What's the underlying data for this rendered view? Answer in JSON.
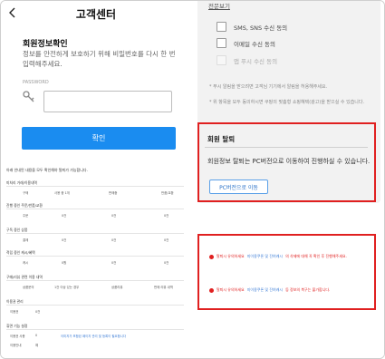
{
  "left": {
    "title": "고객센터",
    "section_title": "회원정보확인",
    "section_desc": "정보를 안전하게 보호하기 위해 비밀번호를 다시 한 번 입력해주세요.",
    "password_label": "PASSWORD",
    "password_value": "",
    "confirm_label": "확인"
  },
  "doc": {
    "note": "아래 안내된 내용을 모두 확인해야 탈퇴가 가능합니다.",
    "sections": [
      "미처리 거래/이용내역",
      "진행 중인 주문/반품/교환",
      "구독 중인 상품",
      "적립 중인 캐시/혜택",
      "구매/리뷰 관련 이용 내역",
      "이용권 관리",
      "휴면 기능 설정"
    ],
    "row1": [
      "구매",
      "사용 중 1개",
      "판매중",
      "반품/교환"
    ],
    "row2": [
      "주문",
      "0건",
      "0건",
      "0건"
    ],
    "row3": [
      "결제",
      "0건",
      "0건",
      "0건"
    ],
    "row4": [
      "캐시",
      "0원",
      "0건",
      "0건"
    ],
    "row5": [
      "상품문의",
      "1건 이상 있는 경우",
      "상품리뷰",
      "판매 리뷰 내역"
    ],
    "row6": [
      "이용권",
      "0건"
    ],
    "row7": [
      "이용권 사용",
      "0",
      "이미지가 포함된 페이지 관리 및 등록이 필요합니다"
    ],
    "row8": [
      "이용안내",
      "예"
    ]
  },
  "right": {
    "view_all": "전문보기",
    "sms_label": "SMS, SNS 수신 동의",
    "email_label": "이메일 수신 동의",
    "push_label": "앱 푸시 수신 동의",
    "notice1": "* 푸시 알림을 받으려면 고객님 기기에서 알림을 허용해주세요.",
    "notice2": "* 위 항목을 모두 동의하시면 쿠팡의 맞춤형 쇼핑혜택(광고)을 받으실 수 있습니다.",
    "withdraw_title": "회원 탈퇴",
    "withdraw_desc": "회원정보 탈퇴는 PC버전으로 이동하여 진행하실 수 있습니다.",
    "pc_button": "PC버전으로 이동",
    "err1_prefix": "탈퇴시 유의하세요",
    "err1_link": "미이용쿠폰 및 잔여캐시",
    "err1_suffix": "의 삭제에 대해 꼭 확인 후 진행해주세요.",
    "err2_prefix": "탈퇴시 유의하세요",
    "err2_link": "미이용쿠폰 및 잔여캐시",
    "err2_suffix": "등 정보의 복구는 불가합니다."
  },
  "colors": {
    "accent": "#1a8cf0",
    "highlight": "#e02020"
  }
}
